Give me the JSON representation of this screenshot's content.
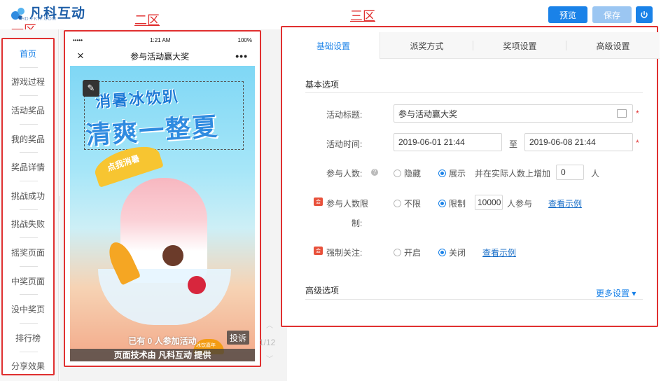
{
  "header": {
    "logo_text": "凡科互动",
    "logo_sub": "HD.FKW.COM",
    "preview_label": "预览",
    "save_label": "保存",
    "power_icon": "power-icon"
  },
  "zones": {
    "zone1": "一区",
    "zone2": "二区",
    "zone3": "三区"
  },
  "leftnav": {
    "items": [
      {
        "label": "首页",
        "active": true
      },
      {
        "label": "游戏过程"
      },
      {
        "label": "活动奖品"
      },
      {
        "label": "我的奖品"
      },
      {
        "label": "奖品详情"
      },
      {
        "label": "挑战成功"
      },
      {
        "label": "挑战失败"
      },
      {
        "label": "摇奖页面"
      },
      {
        "label": "中奖页面"
      },
      {
        "label": "没中奖页"
      },
      {
        "label": "排行榜"
      },
      {
        "label": "分享效果"
      }
    ]
  },
  "phone": {
    "status_carrier": "•••••",
    "status_time": "1:21 AM",
    "status_battery": "100%",
    "title": "参与活动赢大奖",
    "close_icon": "×",
    "more_icon": "•••",
    "poster_line1": "消暑冰饮趴",
    "poster_line2": "清爽一整夏",
    "umbrella_text": "点我消暑",
    "fruit_label": "冰饮嘉年",
    "join_text": "已有 0 人参加活动",
    "report_label": "投诉",
    "tech_text": "页面技术由 凡科互动 提供",
    "pager": "1/12"
  },
  "tabs": [
    {
      "label": "基础设置",
      "active": true
    },
    {
      "label": "派奖方式"
    },
    {
      "label": "奖项设置"
    },
    {
      "label": "高级设置"
    }
  ],
  "basic": {
    "section_title": "基本选项",
    "title_label": "活动标题:",
    "title_value": "参与活动赢大奖",
    "time_label": "活动时间:",
    "time_start": "2019-06-01 21:44",
    "time_to": "至",
    "time_end": "2019-06-08 21:44",
    "participants_label": "参与人数:",
    "participants_hide": "隐藏",
    "participants_show": "展示",
    "participants_extra": "并在实际人数上增加",
    "participants_add_value": "0",
    "participants_unit": "人",
    "limit_label_1": "参与人数限",
    "limit_label_2": "制:",
    "limit_none": "不限",
    "limit_on": "限制",
    "limit_value": "10000",
    "limit_suffix": "人参与",
    "limit_example": "查看示例",
    "follow_label": "强制关注:",
    "follow_on": "开启",
    "follow_off": "关闭",
    "follow_example": "查看示例",
    "required_mark": "*",
    "badge_text": "会"
  },
  "advanced": {
    "section_title": "高级选项",
    "more_label": "更多设置 ▾"
  }
}
